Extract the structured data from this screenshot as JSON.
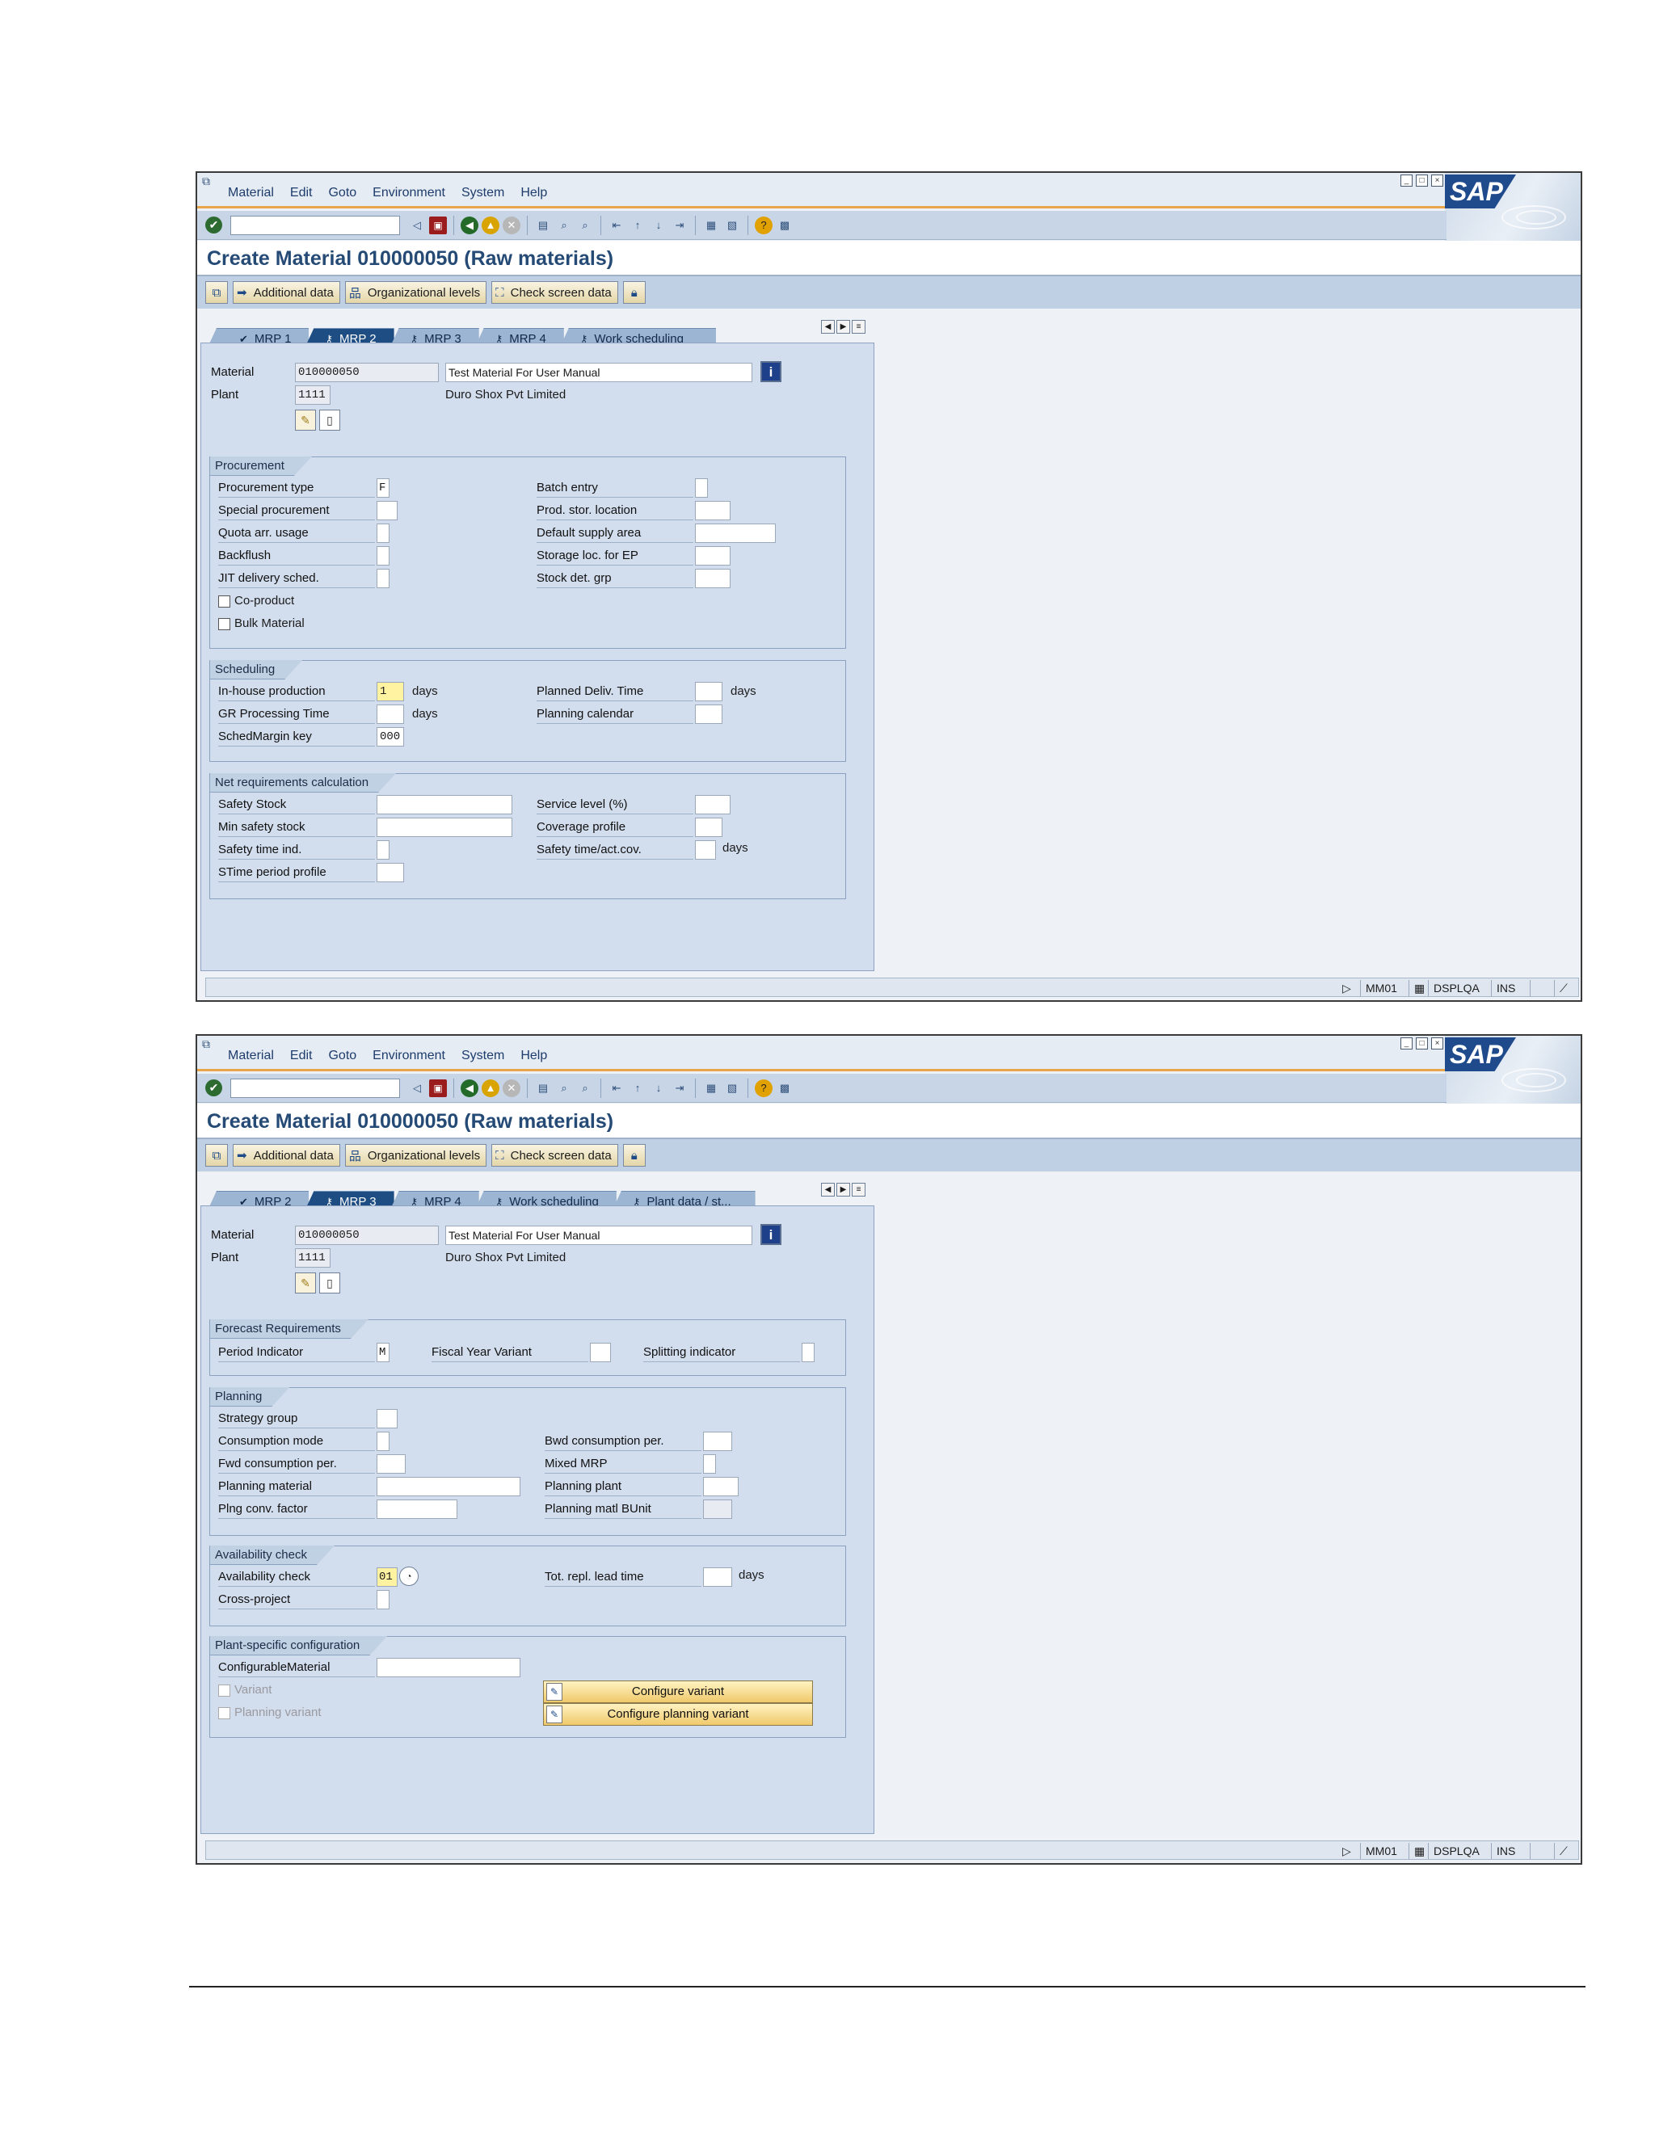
{
  "menu": [
    "Material",
    "Edit",
    "Goto",
    "Environment",
    "System",
    "Help"
  ],
  "sap_logo": "SAP",
  "title": "Create Material 010000050 (Raw materials)",
  "app_toolbar": {
    "additional_data": "Additional data",
    "org_levels": "Organizational levels",
    "check_screen": "Check screen data"
  },
  "status": {
    "arrow": "▷",
    "transaction": "MM01",
    "server": "DSPLQA",
    "mode": "INS"
  },
  "header": {
    "material_label": "Material",
    "material_value": "010000050",
    "material_desc": "Test Material For User Manual",
    "plant_label": "Plant",
    "plant_value": "1111",
    "plant_desc": "Duro Shox Pvt Limited"
  },
  "screen1": {
    "tabs": [
      "MRP 1",
      "MRP 2",
      "MRP 3",
      "MRP 4",
      "Work scheduling"
    ],
    "active_tab": "MRP 2",
    "procurement": {
      "title": "Procurement",
      "procurement_type": "Procurement type",
      "procurement_type_value": "F",
      "special_procurement": "Special procurement",
      "quota_usage": "Quota arr. usage",
      "backflush": "Backflush",
      "jit": "JIT delivery sched.",
      "co_product": "Co-product",
      "bulk_material": "Bulk Material",
      "batch_entry": "Batch entry",
      "prod_stor": "Prod. stor. location",
      "default_supply": "Default supply area",
      "storage_ep": "Storage loc. for EP",
      "stock_det": "Stock det. grp"
    },
    "scheduling": {
      "title": "Scheduling",
      "inhouse": "In-house production",
      "inhouse_value": "1",
      "gr_time": "GR Processing Time",
      "sched_margin": "SchedMargin key",
      "sched_margin_value": "000",
      "planned_deliv": "Planned Deliv. Time",
      "planning_cal": "Planning calendar",
      "days": "days"
    },
    "net_req": {
      "title": "Net requirements calculation",
      "safety_stock": "Safety Stock",
      "min_safety": "Min safety stock",
      "safety_time_ind": "Safety time ind.",
      "stime_profile": "STime period profile",
      "service_level": "Service level (%)",
      "coverage": "Coverage profile",
      "safety_time_act": "Safety time/act.cov.",
      "days": "days"
    }
  },
  "screen2": {
    "tabs": [
      "MRP 2",
      "MRP 3",
      "MRP 4",
      "Work scheduling",
      "Plant data / st..."
    ],
    "active_tab": "MRP 3",
    "forecast": {
      "title": "Forecast Requirements",
      "period": "Period Indicator",
      "period_value": "M",
      "fiscal": "Fiscal Year Variant",
      "splitting": "Splitting indicator"
    },
    "planning": {
      "title": "Planning",
      "strategy": "Strategy group",
      "consumption_mode": "Consumption mode",
      "fwd": "Fwd consumption per.",
      "planning_material": "Planning material",
      "plng_conv": "Plng conv. factor",
      "bwd": "Bwd consumption per.",
      "mixed": "Mixed MRP",
      "planning_plant": "Planning plant",
      "planning_buint": "Planning matl BUnit"
    },
    "availability": {
      "title": "Availability check",
      "avail": "Availability check",
      "avail_value": "01",
      "cross": "Cross-project",
      "tot_repl": "Tot. repl. lead time",
      "days": "days"
    },
    "plant_config": {
      "title": "Plant-specific configuration",
      "configurable": "ConfigurableMaterial",
      "variant": "Variant",
      "planning_variant": "Planning variant",
      "configure_variant": "Configure variant",
      "configure_planning": "Configure planning variant"
    }
  }
}
